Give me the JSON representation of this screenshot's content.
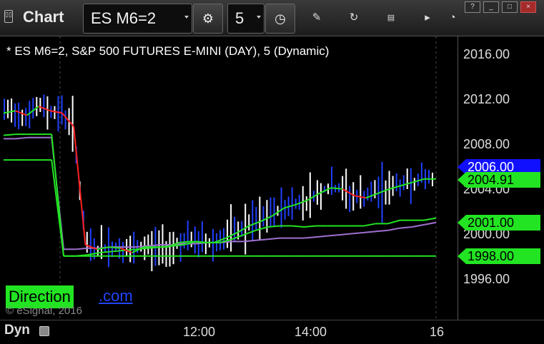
{
  "toolbar": {
    "app_title": "Chart",
    "symbol": "ES M6=2",
    "interval": "5",
    "app_icon_glyph": "▯▯",
    "icons": [
      "settings-gear-icon",
      "clock-icon",
      "pencil-icon",
      "refresh-cycle-icon",
      "get-data-icon",
      "play-icon",
      "clock-small-icon"
    ],
    "window_controls": [
      "?",
      "_",
      "□",
      "×"
    ]
  },
  "chart": {
    "caption": "* ES M6=2, S&P 500 FUTURES E-MINI (DAY), 5 (Dynamic)",
    "price_labels": [
      "2016.00",
      "2012.00",
      "2008.00",
      "2004.00",
      "2000.00",
      "1996.00"
    ],
    "tags": [
      {
        "label": "2006.00",
        "bg": "#1010ff",
        "fg": "#ffffff"
      },
      {
        "label": "2004.91",
        "bg": "#22e422",
        "fg": "#000000"
      },
      {
        "label": "2001.00",
        "bg": "#22e422",
        "fg": "#000000"
      },
      {
        "label": "1998.00",
        "bg": "#22e422",
        "fg": "#000000"
      }
    ],
    "time_labels": [
      "12:00",
      "14:00",
      "16"
    ],
    "mode_label": "Dyn",
    "watermark_direction": "Direction",
    "watermark_com": ".com",
    "copyright": "© eSignal, 2016"
  },
  "chart_data": {
    "type": "line",
    "ylim": [
      1993,
      2019
    ],
    "series": [
      {
        "values": [
          2010.8,
          2011.0,
          2010.6,
          2011.4,
          2011.0,
          2010.8,
          2009.6,
          1999.0,
          1998.6,
          1998.8,
          1998.7,
          1998.3,
          1998.8,
          1998.8,
          1998.8,
          1999.2,
          1999.3,
          1999.2,
          1999.2,
          1999.6,
          2000.1,
          2000.7,
          2001.1,
          2001.6,
          2002.3,
          2002.6,
          2003.0,
          2003.6,
          2004.1,
          2004.0,
          2003.4,
          2003.2,
          2003.6,
          2004.0,
          2004.3,
          2004.6,
          2004.9,
          2004.9
        ]
      },
      {
        "values": [
          2008.8,
          2008.9,
          2008.9,
          2008.9,
          2008.9,
          1998.0,
          1998.0,
          1998.1,
          1998.3,
          1998.4,
          1998.5,
          1998.6,
          1998.7,
          1998.8,
          1998.9,
          1999.0,
          1999.3,
          1999.2,
          1999.2,
          1999.5,
          1999.9,
          2000.3,
          2000.6,
          2000.7,
          2000.7,
          2000.6,
          2000.7,
          2000.7,
          2000.7,
          2000.7,
          2000.7,
          2000.9,
          2000.9,
          2001.2,
          2001.2,
          2001.2,
          2001.4
        ]
      },
      {
        "values": [
          2008.5,
          2008.5,
          2008.6,
          2008.6,
          2008.6,
          1998.6,
          1998.6,
          1998.7,
          1998.7,
          1998.8,
          1998.8,
          1998.8,
          1998.9,
          1999.0,
          1999.0,
          1999.1,
          1999.1,
          1999.2,
          1999.2,
          1999.3,
          1999.3,
          1999.4,
          1999.5,
          1999.6,
          1999.6,
          1999.6,
          1999.7,
          1999.8,
          1999.9,
          2000.0,
          2000.1,
          2000.2,
          2000.3,
          2000.5,
          2000.6,
          2000.8,
          2001.0
        ]
      },
      {
        "values": [
          2006.6,
          2006.6,
          2006.6,
          2006.6,
          2006.6,
          1998.0,
          1998.0,
          1998.0,
          1998.0,
          1998.0,
          1998.0,
          1998.0,
          1998.0,
          1998.0,
          1998.0,
          1998.0,
          1998.0,
          1998.0,
          1998.0,
          1998.0,
          1998.0,
          1998.0,
          1998.0,
          1998.0,
          1998.0,
          1998.0,
          1998.0,
          1998.0,
          1998.0,
          1998.0,
          1998.0,
          1998.0,
          1998.0,
          1998.0,
          1998.0,
          1998.0,
          1998.0
        ]
      }
    ]
  },
  "colors": {
    "ma_fast_green": "#22e422",
    "ma_fast_red": "#ff2020",
    "ma_slow_green": "#22e422",
    "ma_purple": "#a070d0",
    "support_green": "#22e422",
    "bar_up": "#ffffff",
    "bar_down": "#2040ff",
    "grid": "#4a4a4a"
  }
}
